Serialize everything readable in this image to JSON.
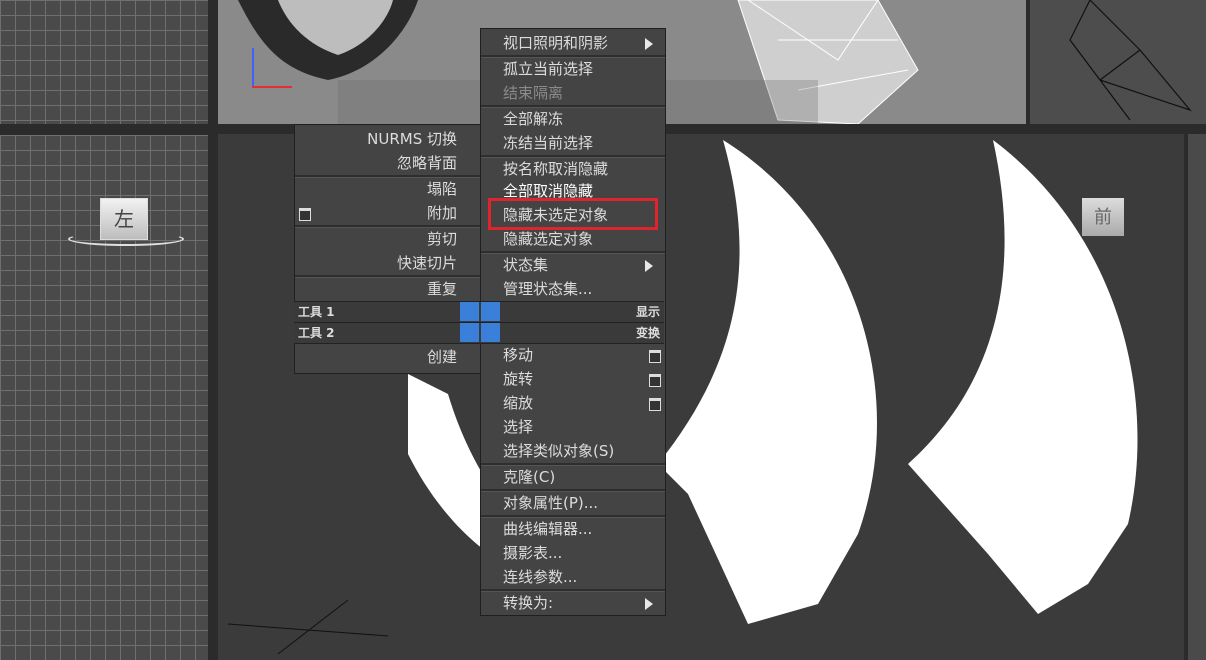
{
  "viewports": {
    "left_cube_label": "左",
    "right_cube_label": "前"
  },
  "quad_menu": {
    "left_items": [
      "NURMS 切换",
      "忽略背面",
      "塌陷",
      "附加",
      "剪切",
      "快速切片",
      "重复",
      "创建"
    ],
    "left_labels": {
      "tools1": "工具 1",
      "tools2": "工具 2"
    },
    "right_labels": {
      "display": "显示",
      "transform": "变换"
    },
    "display_items": [
      "视口照明和阴影",
      "孤立当前选择",
      "结束隔离",
      "全部解冻",
      "冻结当前选择",
      "按名称取消隐藏",
      "全部取消隐藏",
      "隐藏未选定对象",
      "隐藏选定对象",
      "状态集",
      "管理状态集..."
    ],
    "transform_items": [
      "移动",
      "旋转",
      "缩放",
      "选择",
      "选择类似对象(S)",
      "克隆(C)",
      "对象属性(P)...",
      "曲线编辑器...",
      "摄影表...",
      "连线参数...",
      "转换为:"
    ],
    "highlighted_item": "隐藏未选定对象"
  }
}
